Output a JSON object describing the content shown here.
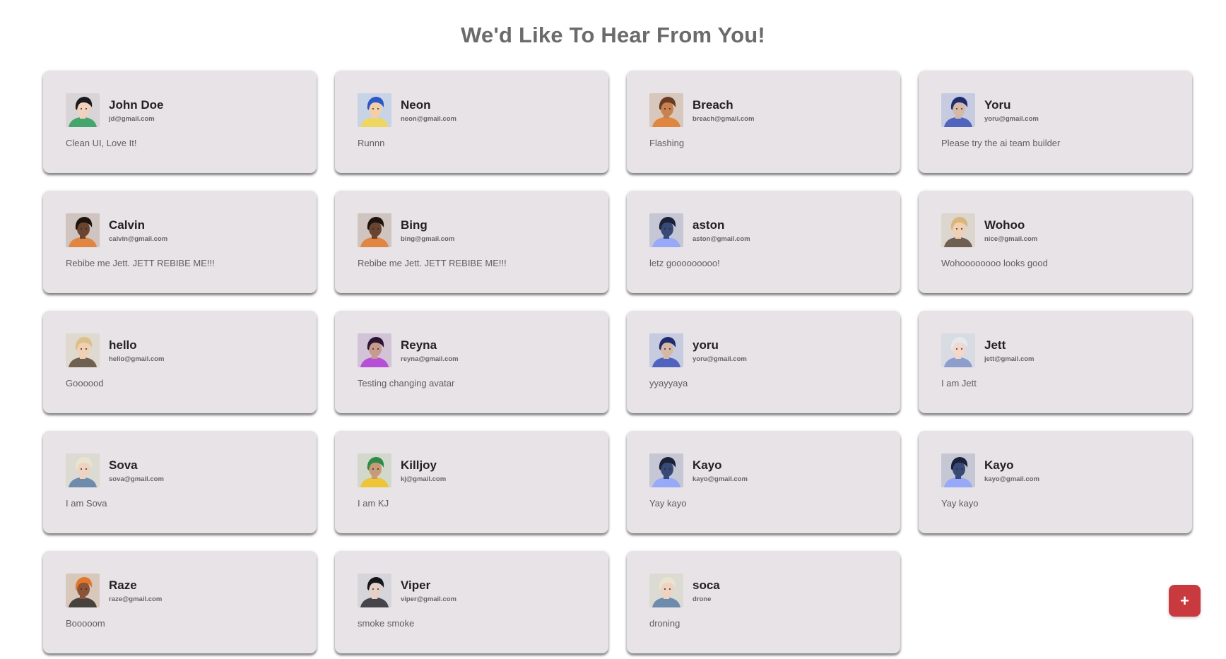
{
  "page": {
    "title": "We'd Like To Hear From You!"
  },
  "colors": {
    "card_bg": "#e7e3e6",
    "title": "#6b6b6b",
    "fab": "#c93a3f"
  },
  "fab": {
    "label": "+",
    "icon": "plus-icon"
  },
  "feedback": [
    {
      "name": "John Doe",
      "email": "jd@gmail.com",
      "message": "Clean UI, Love It!",
      "avatar": "agent-black-hair",
      "skin": "#f1d1bd",
      "hair": "#1b1b1f",
      "bg": "#d9d4d6",
      "accent": "#2a9d5b"
    },
    {
      "name": "Neon",
      "email": "neon@gmail.com",
      "message": "Runnn",
      "avatar": "agent-blue-hair",
      "skin": "#f2cfa8",
      "hair": "#2a58c7",
      "bg": "#c9d3e6",
      "accent": "#f5d64a"
    },
    {
      "name": "Breach",
      "email": "breach@gmail.com",
      "message": "Flashing",
      "avatar": "agent-bearded",
      "skin": "#c88250",
      "hair": "#6b3b22",
      "bg": "#d7c7bd",
      "accent": "#e07a2c"
    },
    {
      "name": "Yoru",
      "email": "yoru@gmail.com",
      "message": "Please try the ai team builder",
      "avatar": "agent-dark-blue",
      "skin": "#d7b7a5",
      "hair": "#1f2c6e",
      "bg": "#c6cbe0",
      "accent": "#3b52b8"
    },
    {
      "name": "Calvin",
      "email": "calvin@gmail.com",
      "message": "Rebibe me Jett. JETT REBIBE ME!!!",
      "avatar": "agent-phoenix",
      "skin": "#6b4430",
      "hair": "#1d1410",
      "bg": "#cfc4bf",
      "accent": "#e47a2b"
    },
    {
      "name": "Bing",
      "email": "bing@gmail.com",
      "message": "Rebibe me Jett. JETT REBIBE ME!!!",
      "avatar": "agent-phoenix",
      "skin": "#6b4430",
      "hair": "#1d1410",
      "bg": "#cfc4bf",
      "accent": "#e47a2b"
    },
    {
      "name": "aston",
      "email": "aston@gmail.com",
      "message": "letz gooooooooo!",
      "avatar": "agent-robot",
      "skin": "#3a4a78",
      "hair": "#1a2138",
      "bg": "#c5c8d4",
      "accent": "#8fa3ff"
    },
    {
      "name": "Wohoo",
      "email": "nice@gmail.com",
      "message": "Wohoooooooo looks good",
      "avatar": "agent-blonde",
      "skin": "#f0cfb3",
      "hair": "#d9b67a",
      "bg": "#ddd6cf",
      "accent": "#5b4a3c"
    },
    {
      "name": "hello",
      "email": "hello@gmail.com",
      "message": "Goooood",
      "avatar": "agent-blonde",
      "skin": "#f0cfb3",
      "hair": "#dcc08a",
      "bg": "#e0d9d0",
      "accent": "#5b4a3c"
    },
    {
      "name": "Reyna",
      "email": "reyna@gmail.com",
      "message": "Testing changing avatar",
      "avatar": "agent-purple",
      "skin": "#c79a8e",
      "hair": "#2a1533",
      "bg": "#d2c3d6",
      "accent": "#b23bd6"
    },
    {
      "name": "yoru",
      "email": "yoru@gmail.com",
      "message": "yyayyaya",
      "avatar": "agent-dark-blue",
      "skin": "#d7b7a5",
      "hair": "#1f2c6e",
      "bg": "#c6cbe0",
      "accent": "#3b52b8"
    },
    {
      "name": "Jett",
      "email": "jett@gmail.com",
      "message": "I am Jett",
      "avatar": "agent-white-hair",
      "skin": "#f3d8c9",
      "hair": "#e6e8ef",
      "bg": "#d9dbe3",
      "accent": "#7f93c9"
    },
    {
      "name": "Sova",
      "email": "sova@gmail.com",
      "message": "I am Sova",
      "avatar": "agent-sova",
      "skin": "#efd2bf",
      "hair": "#e9e3cf",
      "bg": "#dcdbd3",
      "accent": "#5a7ba6"
    },
    {
      "name": "Killjoy",
      "email": "kj@gmail.com",
      "message": "I am KJ",
      "avatar": "agent-green-hat",
      "skin": "#c99a77",
      "hair": "#2f8a48",
      "bg": "#d3d8cc",
      "accent": "#f2c21b"
    },
    {
      "name": "Kayo",
      "email": "kayo@gmail.com",
      "message": "Yay kayo",
      "avatar": "agent-robot",
      "skin": "#3a4a78",
      "hair": "#1a2138",
      "bg": "#c5c8d4",
      "accent": "#8fa3ff"
    },
    {
      "name": "Kayo",
      "email": "kayo@gmail.com",
      "message": "Yay kayo",
      "avatar": "agent-robot",
      "skin": "#3a4a78",
      "hair": "#1a2138",
      "bg": "#c5c8d4",
      "accent": "#8fa3ff"
    },
    {
      "name": "Raze",
      "email": "raze@gmail.com",
      "message": "Booooom",
      "avatar": "agent-orange-cap",
      "skin": "#8a5438",
      "hair": "#e3762a",
      "bg": "#d8c8bc",
      "accent": "#2e2a28"
    },
    {
      "name": "Viper",
      "email": "viper@gmail.com",
      "message": "smoke smoke",
      "avatar": "agent-masked",
      "skin": "#e6cfc4",
      "hair": "#14161c",
      "bg": "#d6d6da",
      "accent": "#2b2b31"
    },
    {
      "name": "soca",
      "email": "drone",
      "message": "droning",
      "avatar": "agent-sova",
      "skin": "#efd2bf",
      "hair": "#e9e3cf",
      "bg": "#dcdbd3",
      "accent": "#5a7ba6"
    }
  ]
}
